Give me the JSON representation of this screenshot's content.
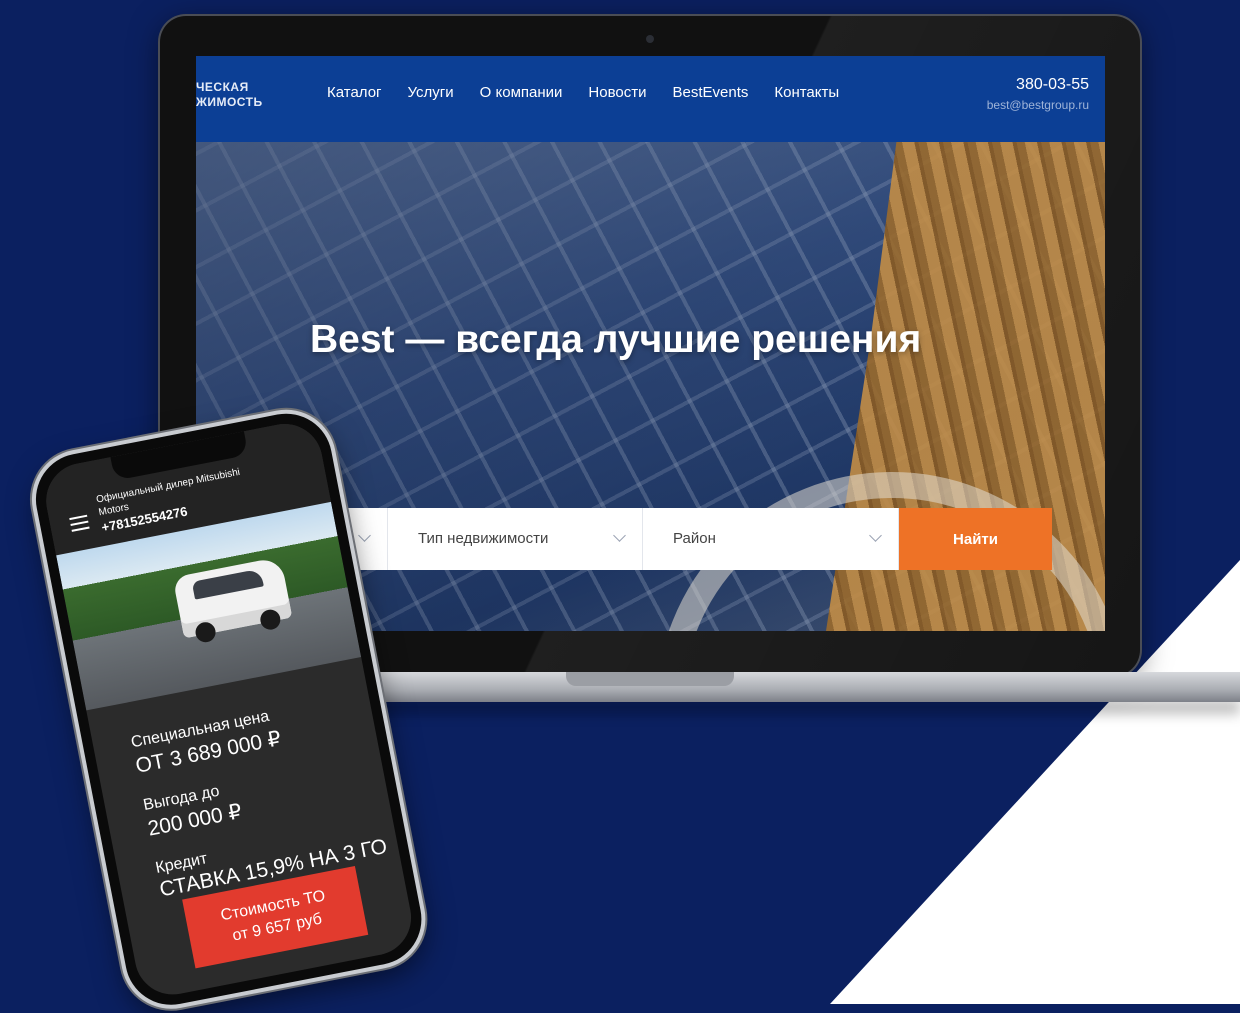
{
  "laptop": {
    "logo_lines": [
      "ЧЕСКАЯ",
      "ЖИМОСТЬ"
    ],
    "nav": {
      "items": [
        {
          "label": "Каталог"
        },
        {
          "label": "Услуги"
        },
        {
          "label": "О компании"
        },
        {
          "label": "Новости"
        },
        {
          "label": "BestEvents"
        },
        {
          "label": "Контакты"
        }
      ],
      "phone": "380-03-55",
      "email": "best@bestgroup.ru"
    },
    "hero": {
      "title": "Best — всегда лучшие решения"
    },
    "search": {
      "selects": [
        {
          "label": "е",
          "icon": "chevron-down-icon"
        },
        {
          "label": "Тип недвижимости",
          "icon": "chevron-down-icon"
        },
        {
          "label": "Район",
          "icon": "chevron-down-icon"
        }
      ],
      "button_label": "Найти",
      "button_color": "#ee7226"
    },
    "nav_color": "#0c3f95"
  },
  "phone": {
    "dealer_line1": "Официальный дилер Mitsubishi",
    "dealer_line2": "Motors",
    "phone_number": "+78152554276",
    "menu_icon": "menu-icon",
    "offers": [
      {
        "label": "Специальная цена",
        "value": "ОТ 3 689 000 ₽"
      },
      {
        "label": "Выгода до",
        "value": "200 000 ₽"
      },
      {
        "label": "Кредит",
        "value": "СТАВКА 15,9% НА 3 ГО"
      }
    ],
    "cta": {
      "line1": "Стоимость ТО",
      "line2": "от 9 657 руб",
      "color": "#e23b2e"
    }
  },
  "colors": {
    "background": "#0b2060",
    "accent_white": "#ffffff"
  }
}
